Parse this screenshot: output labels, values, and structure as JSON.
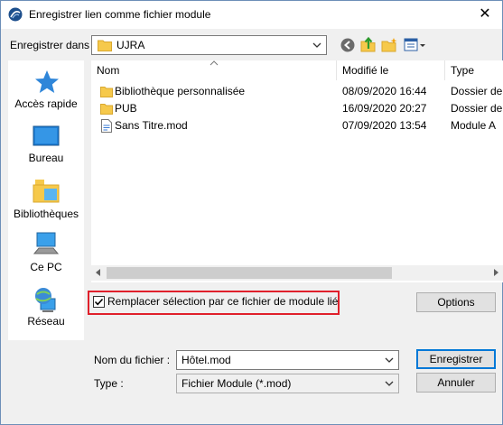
{
  "window": {
    "title": "Enregistrer lien comme fichier module",
    "close_glyph": "✕"
  },
  "location": {
    "label": "Enregistrer dans :",
    "current_folder": "UJRA",
    "toolbar_icons": [
      "back-icon",
      "up-folder-icon",
      "new-folder-icon",
      "view-menu-icon"
    ]
  },
  "places": [
    {
      "label": "Accès rapide",
      "icon": "quick-access-icon"
    },
    {
      "label": "Bureau",
      "icon": "desktop-icon"
    },
    {
      "label": "Bibliothèques",
      "icon": "libraries-icon"
    },
    {
      "label": "Ce PC",
      "icon": "computer-icon"
    },
    {
      "label": "Réseau",
      "icon": "network-icon"
    }
  ],
  "filelist": {
    "columns": [
      "Nom",
      "Modifié le",
      "Type"
    ],
    "rows": [
      {
        "name": "Bibliothèque personnalisée",
        "modified": "08/09/2020 16:44",
        "type": "Dossier de",
        "icon": "folder-icon"
      },
      {
        "name": "PUB",
        "modified": "16/09/2020 20:27",
        "type": "Dossier de",
        "icon": "folder-icon"
      },
      {
        "name": "Sans Titre.mod",
        "modified": "07/09/2020 13:54",
        "type": "Module A",
        "icon": "module-file-icon"
      }
    ]
  },
  "options": {
    "replace_label": "Remplacer sélection par ce fichier de module lié",
    "replace_checked": true,
    "options_button": "Options"
  },
  "form": {
    "filename_label": "Nom du fichier :",
    "filename_value": "Hôtel.mod",
    "type_label": "Type :",
    "type_value": "Fichier Module (*.mod)",
    "save_button": "Enregistrer",
    "cancel_button": "Annuler"
  },
  "colors": {
    "accent": "#0078d7",
    "highlight_border": "#e0202b",
    "folder": "#f6c94b"
  }
}
